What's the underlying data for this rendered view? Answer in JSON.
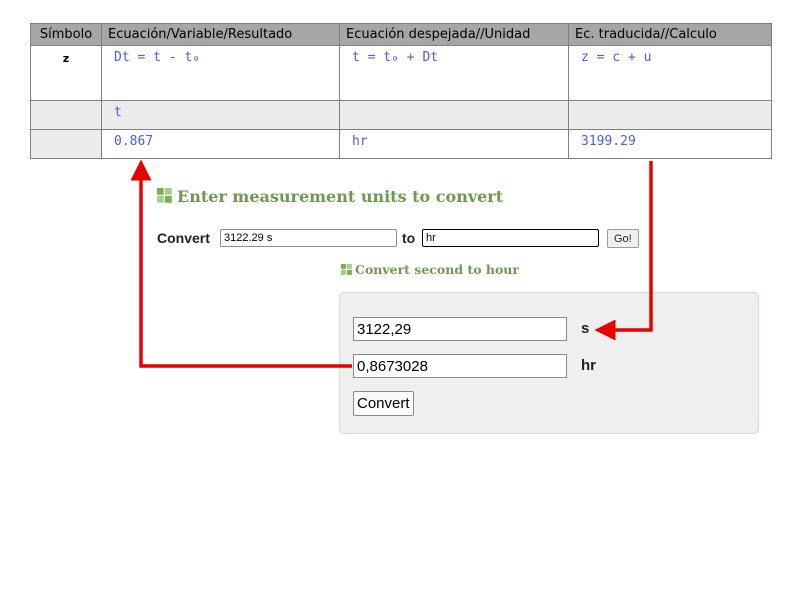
{
  "table": {
    "headers": [
      "Símbolo",
      "Ecuación/Variable/Resultado",
      "Ecuación despejada//Unidad",
      "Ec. traducida//Calculo"
    ],
    "rows": [
      [
        "z",
        "Dt = t - t₀",
        "t = t₀ + Dt",
        "z = c + u"
      ],
      [
        "",
        "t",
        "",
        ""
      ],
      [
        "",
        "0.867",
        "hr",
        "3199.29"
      ]
    ]
  },
  "converter": {
    "title": "Enter measurement units to convert",
    "convert_label": "Convert",
    "from_value": "3122.29 s",
    "to_label": "to",
    "to_value": "hr",
    "go_label": "Go!",
    "subtitle": "Convert second to hour",
    "panel": {
      "value_1": "3122,29",
      "unit_1": "s",
      "value_2": "0,8673028",
      "unit_2": "hr",
      "convert_button": "Convert"
    }
  },
  "colors": {
    "annotation_arrow": "#e60000",
    "handwritten_text": "#4a5fd8",
    "converter_title": "#6d9a4f"
  }
}
